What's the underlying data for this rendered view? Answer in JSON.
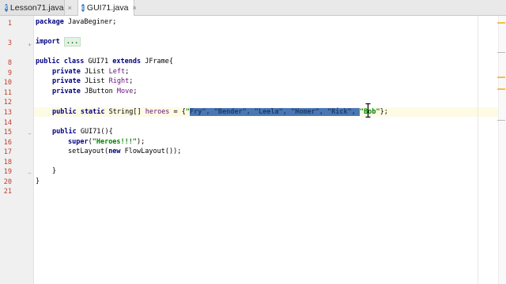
{
  "tabs": [
    {
      "label": "Lesson71.java",
      "icon": "java-class-icon",
      "close": "×"
    },
    {
      "label": "GUI71.java",
      "icon": "java-class-icon",
      "close": "×"
    }
  ],
  "editor": {
    "line_numbers": [
      "1",
      "3",
      "8",
      "9",
      "10",
      "11",
      "12",
      "13",
      "14",
      "15",
      "16",
      "17",
      "18",
      "19",
      "20",
      "21"
    ],
    "lines": {
      "l1": {
        "kw": "package",
        "rest": " JavaBeginer;"
      },
      "l3": {
        "kw": "import",
        "dots": "..."
      },
      "l8": {
        "kw1": "public class",
        "name": " GUI71 ",
        "kw2": "extends",
        "rest": " JFrame{"
      },
      "l9": {
        "kw": "private",
        "type": " JList ",
        "field": "Left",
        "end": ";"
      },
      "l10": {
        "kw": "private",
        "type": " JList ",
        "field": "Right",
        "end": ";"
      },
      "l11": {
        "kw": "private",
        "type": " JButton ",
        "field": "Move",
        "end": ";"
      },
      "l13": {
        "kw": "public static",
        "type": " String[] ",
        "field": "heroes",
        "eq": " = {",
        "sel_pre": "\"",
        "sel_mid": "Fry\", \"Bender\", \"Leela\", \"Homer\", \"Rick\", ",
        "after": "\"Bob\"",
        "end": "};"
      },
      "l15": {
        "kw": "public",
        "rest": " GUI71(){"
      },
      "l16": {
        "kw": "super",
        "open": "(",
        "str": "\"Heroes!!!\"",
        "close": ");"
      },
      "l17": {
        "pre": "setLayout(",
        "kw": "new",
        "rest": " FlowLayout());"
      },
      "l19": {
        "text": "}"
      },
      "l20": {
        "text": "}"
      }
    }
  }
}
